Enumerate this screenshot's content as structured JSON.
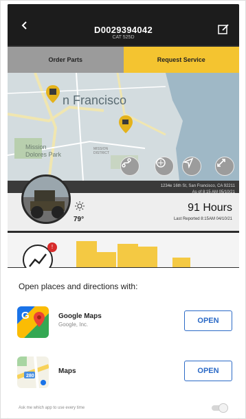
{
  "header": {
    "title": "D0029394042",
    "subtitle": "CAT 525D",
    "back_icon": "chevron-left-icon",
    "edit_icon": "edit-icon"
  },
  "tabs": [
    {
      "label": "Order Parts",
      "active": false
    },
    {
      "label": "Request Service",
      "active": true
    }
  ],
  "map": {
    "city_label": "n Francisco",
    "district_label": "Mission\nDolores Park",
    "district2_label": "MISSION\nDISTRICT",
    "buttons": [
      "route-icon",
      "layers-icon",
      "navigate-icon",
      "expand-icon"
    ],
    "pins": [
      "building-pin-icon",
      "truck-pin-icon"
    ]
  },
  "machine": {
    "address_line1": "1234e 16th St, San Francisco, CA 92211",
    "address_line2": "As of 8:15 AM 05/10/21",
    "temperature": "79°",
    "hours": "91 Hours",
    "last_reported": "Last Reported 8:15AM 04/10/21",
    "alert_count": "!"
  },
  "sheet": {
    "title": "Open places and directions with:",
    "apps": [
      {
        "name": "Google Maps",
        "publisher": "Google, Inc.",
        "button": "OPEN",
        "icon": "google-maps-icon"
      },
      {
        "name": "Maps",
        "publisher": "",
        "button": "OPEN",
        "icon": "apple-maps-icon"
      }
    ],
    "ask_text": "Ask me which app to use every time",
    "ask_toggle_on": false
  },
  "colors": {
    "accent_yellow": "#f4c430",
    "link_blue": "#2a69c6",
    "alert_red": "#d72b2b"
  }
}
